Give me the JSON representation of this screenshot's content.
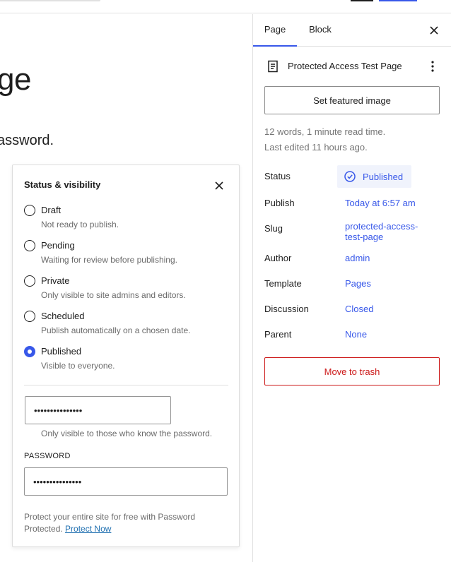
{
  "canvas": {
    "title_fragment": "ge",
    "text_fragment": "assword."
  },
  "popover": {
    "title": "Status & visibility",
    "close_icon": "close-icon",
    "options": [
      {
        "label": "Draft",
        "help": "Not ready to publish.",
        "checked": false
      },
      {
        "label": "Pending",
        "help": "Waiting for review before publishing.",
        "checked": false
      },
      {
        "label": "Private",
        "help": "Only visible to site admins and editors.",
        "checked": false
      },
      {
        "label": "Scheduled",
        "help": "Publish automatically on a chosen date.",
        "checked": false
      },
      {
        "label": "Published",
        "help": "Visible to everyone.",
        "checked": true
      }
    ],
    "inline_password_value": "•••••••••••••••",
    "inline_password_help": "Only visible to those who know the password.",
    "password_label": "PASSWORD",
    "password_value": "•••••••••••••••",
    "promo_text": "Protect your entire site for free with Password Protected.",
    "promo_link": "Protect Now"
  },
  "sidebar": {
    "tabs": [
      {
        "label": "Page",
        "active": true
      },
      {
        "label": "Block",
        "active": false
      }
    ],
    "close_icon": "close-icon",
    "doc_icon": "page-document-icon",
    "doc_title": "Protected Access Test Page",
    "more_icon": "more-vertical-icon",
    "featured_image_label": "Set featured image",
    "meta": {
      "words": "12 words, 1 minute read time.",
      "last_edited": "Last edited 11 hours ago."
    },
    "properties": {
      "status_label": "Status",
      "status_value": "Published",
      "publish_label": "Publish",
      "publish_value": "Today at 6:57 am",
      "slug_label": "Slug",
      "slug_value_line1": "protected-access-",
      "slug_value_line2": "test-page",
      "author_label": "Author",
      "author_value": "admin",
      "template_label": "Template",
      "template_value": "Pages",
      "discussion_label": "Discussion",
      "discussion_value": "Closed",
      "parent_label": "Parent",
      "parent_value": "None"
    },
    "trash_label": "Move to trash"
  },
  "colors": {
    "accent": "#3858e9",
    "danger": "#cc1818",
    "muted": "#757575",
    "link": "#2271b1"
  }
}
